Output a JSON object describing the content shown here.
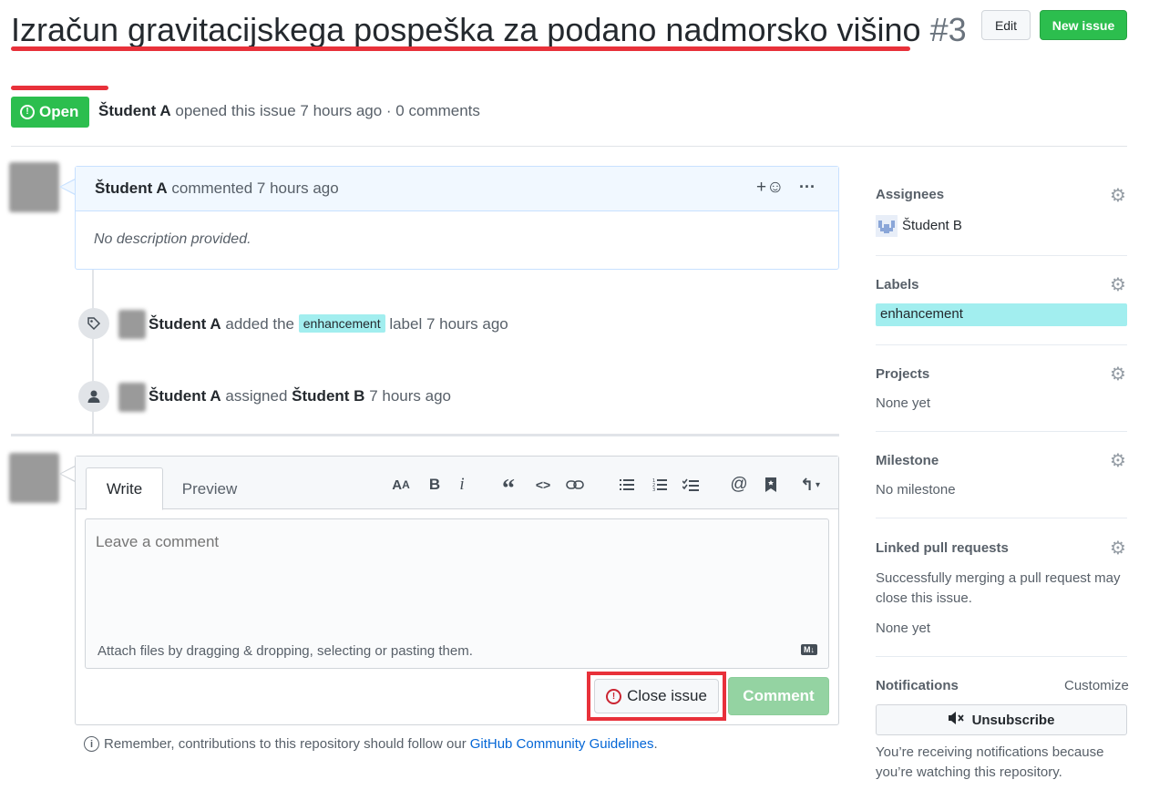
{
  "header": {
    "title": "Izračun gravitacijskega pospeška za podano nadmorsko višino",
    "number": "#3",
    "edit_label": "Edit",
    "new_issue_label": "New issue"
  },
  "status": {
    "state_label": "Open",
    "author": "Študent A",
    "meta_text": "opened this issue 7 hours ago · 0 comments"
  },
  "comment": {
    "author": "Študent A",
    "action": "commented 7 hours ago",
    "reaction_label": "+☺",
    "more_label": "···",
    "body": "No description provided."
  },
  "timeline": [
    {
      "icon": "tag-icon",
      "author": "Študent A",
      "text_before": "added the",
      "label": "enhancement",
      "text_after": "label 7 hours ago"
    },
    {
      "icon": "person-icon",
      "author": "Študent A",
      "text_before": "assigned",
      "target": "Študent B",
      "text_after": "7 hours ago"
    }
  ],
  "editor": {
    "tab_write": "Write",
    "tab_preview": "Preview",
    "toolbar": [
      "AA",
      "B",
      "i",
      "“",
      "<>",
      "link",
      "ul",
      "ol",
      "task",
      "@",
      "bookmark",
      "reply"
    ],
    "placeholder": "Leave a comment",
    "attach_text": "Attach files by dragging & dropping, selecting or pasting them.",
    "md_badge": "M↓",
    "close_issue_label": "Close issue",
    "comment_label": "Comment"
  },
  "reminder": {
    "text": "Remember, contributions to this repository should follow our",
    "link": "GitHub Community Guidelines",
    "end": "."
  },
  "sidebar": {
    "assignees": {
      "title": "Assignees",
      "value": "Študent B"
    },
    "labels": {
      "title": "Labels",
      "value": "enhancement"
    },
    "projects": {
      "title": "Projects",
      "value": "None yet"
    },
    "milestone": {
      "title": "Milestone",
      "value": "No milestone"
    },
    "linked": {
      "title": "Linked pull requests",
      "desc": "Successfully merging a pull request may close this issue.",
      "value": "None yet"
    },
    "notifications": {
      "title": "Notifications",
      "customize": "Customize",
      "unsubscribe": "Unsubscribe",
      "reason": "You’re receiving notifications because you’re watching this repository."
    }
  },
  "colors": {
    "green": "#2cbe4e",
    "label_bg": "#a2eeef",
    "highlight_red": "#e8313a",
    "link_blue": "#0366d6"
  }
}
